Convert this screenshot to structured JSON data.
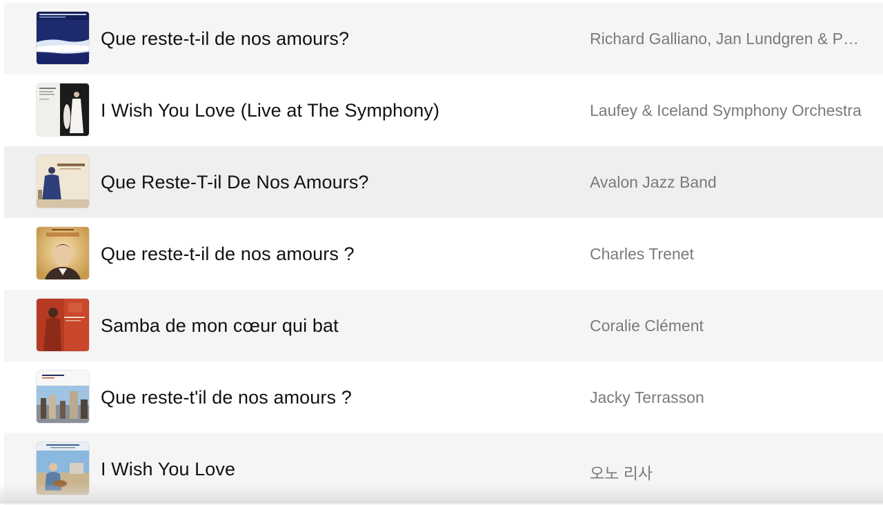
{
  "tracks": [
    {
      "title": "Que reste-t-il de nos amours?",
      "artist": "Richard Galliano, Jan Lundgren & Paolo Fresu",
      "art": "album-art-galliano"
    },
    {
      "title": "I Wish You Love (Live at The Symphony)",
      "artist": "Laufey & Iceland Symphony Orchestra",
      "art": "album-art-laufey"
    },
    {
      "title": "Que Reste-T-il De Nos Amours?",
      "artist": "Avalon Jazz Band",
      "art": "album-art-avalon"
    },
    {
      "title": "Que reste-t-il de nos amours ?",
      "artist": "Charles Trenet",
      "art": "album-art-trenet"
    },
    {
      "title": "Samba de mon cœur qui bat",
      "artist": "Coralie Clément",
      "art": "album-art-clement"
    },
    {
      "title": "Que reste-t'il de nos amours ?",
      "artist": "Jacky Terrasson",
      "art": "album-art-terrasson"
    },
    {
      "title": "I Wish You Love",
      "artist": "오노 리사",
      "art": "album-art-ono-lisa"
    }
  ],
  "colors": {
    "row_shade": "#f5f5f5",
    "row_selected": "#efefef",
    "title_text": "#111111",
    "artist_text": "#7a7a7a"
  }
}
